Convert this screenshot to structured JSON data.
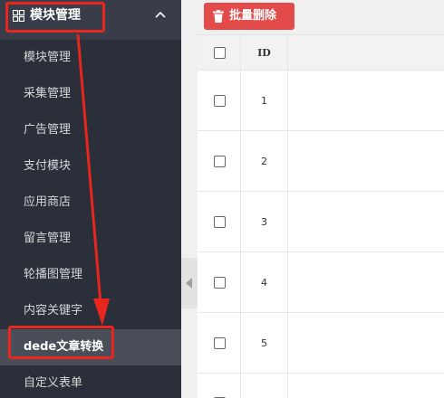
{
  "sidebar": {
    "header_label": "模块管理",
    "header_icon": "grid-icon",
    "items": [
      {
        "label": "模块管理"
      },
      {
        "label": "采集管理"
      },
      {
        "label": "广告管理"
      },
      {
        "label": "支付模块"
      },
      {
        "label": "应用商店"
      },
      {
        "label": "留言管理"
      },
      {
        "label": "轮播图管理"
      },
      {
        "label": "内容关键字"
      },
      {
        "label": "dede文章转换",
        "active": true
      },
      {
        "label": "自定义表单"
      }
    ]
  },
  "toolbar": {
    "delete_label": "批量删除",
    "delete_icon": "trash-icon"
  },
  "table": {
    "columns": [
      "",
      "ID"
    ],
    "rows": [
      "1",
      "2",
      "3",
      "4",
      "5"
    ]
  },
  "colors": {
    "sidebar_bg": "#393d49",
    "submenu_bg": "#2b2f3a",
    "active_bg": "#4a4e58",
    "danger": "#e34b4b",
    "annotation": "#e8261e"
  }
}
